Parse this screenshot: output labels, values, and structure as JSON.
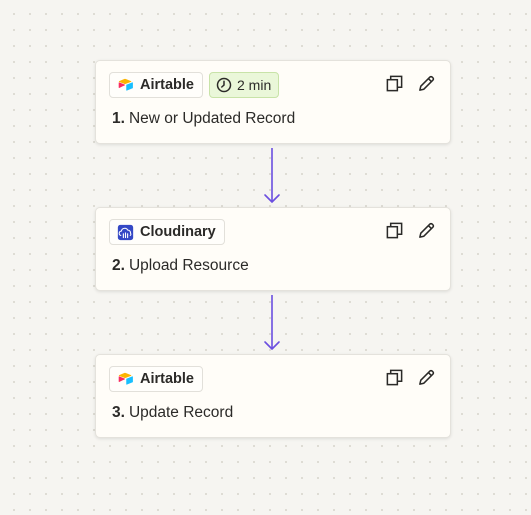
{
  "colors": {
    "canvas_background": "#f6f5f1",
    "card_background": "#fffdf8",
    "connector": "#6b4fe0",
    "time_badge_background": "#eaf7d9",
    "cloudinary_brand": "#3448c5"
  },
  "steps": [
    {
      "number": "1.",
      "title": "New or Updated Record",
      "app_name": "Airtable",
      "app_icon": "airtable-logo",
      "time_badge": "2 min"
    },
    {
      "number": "2.",
      "title": "Upload Resource",
      "app_name": "Cloudinary",
      "app_icon": "cloudinary-logo"
    },
    {
      "number": "3.",
      "title": "Update Record",
      "app_name": "Airtable",
      "app_icon": "airtable-logo"
    }
  ],
  "actions": {
    "copy_icon": "copy-icon",
    "edit_icon": "pencil-icon"
  }
}
